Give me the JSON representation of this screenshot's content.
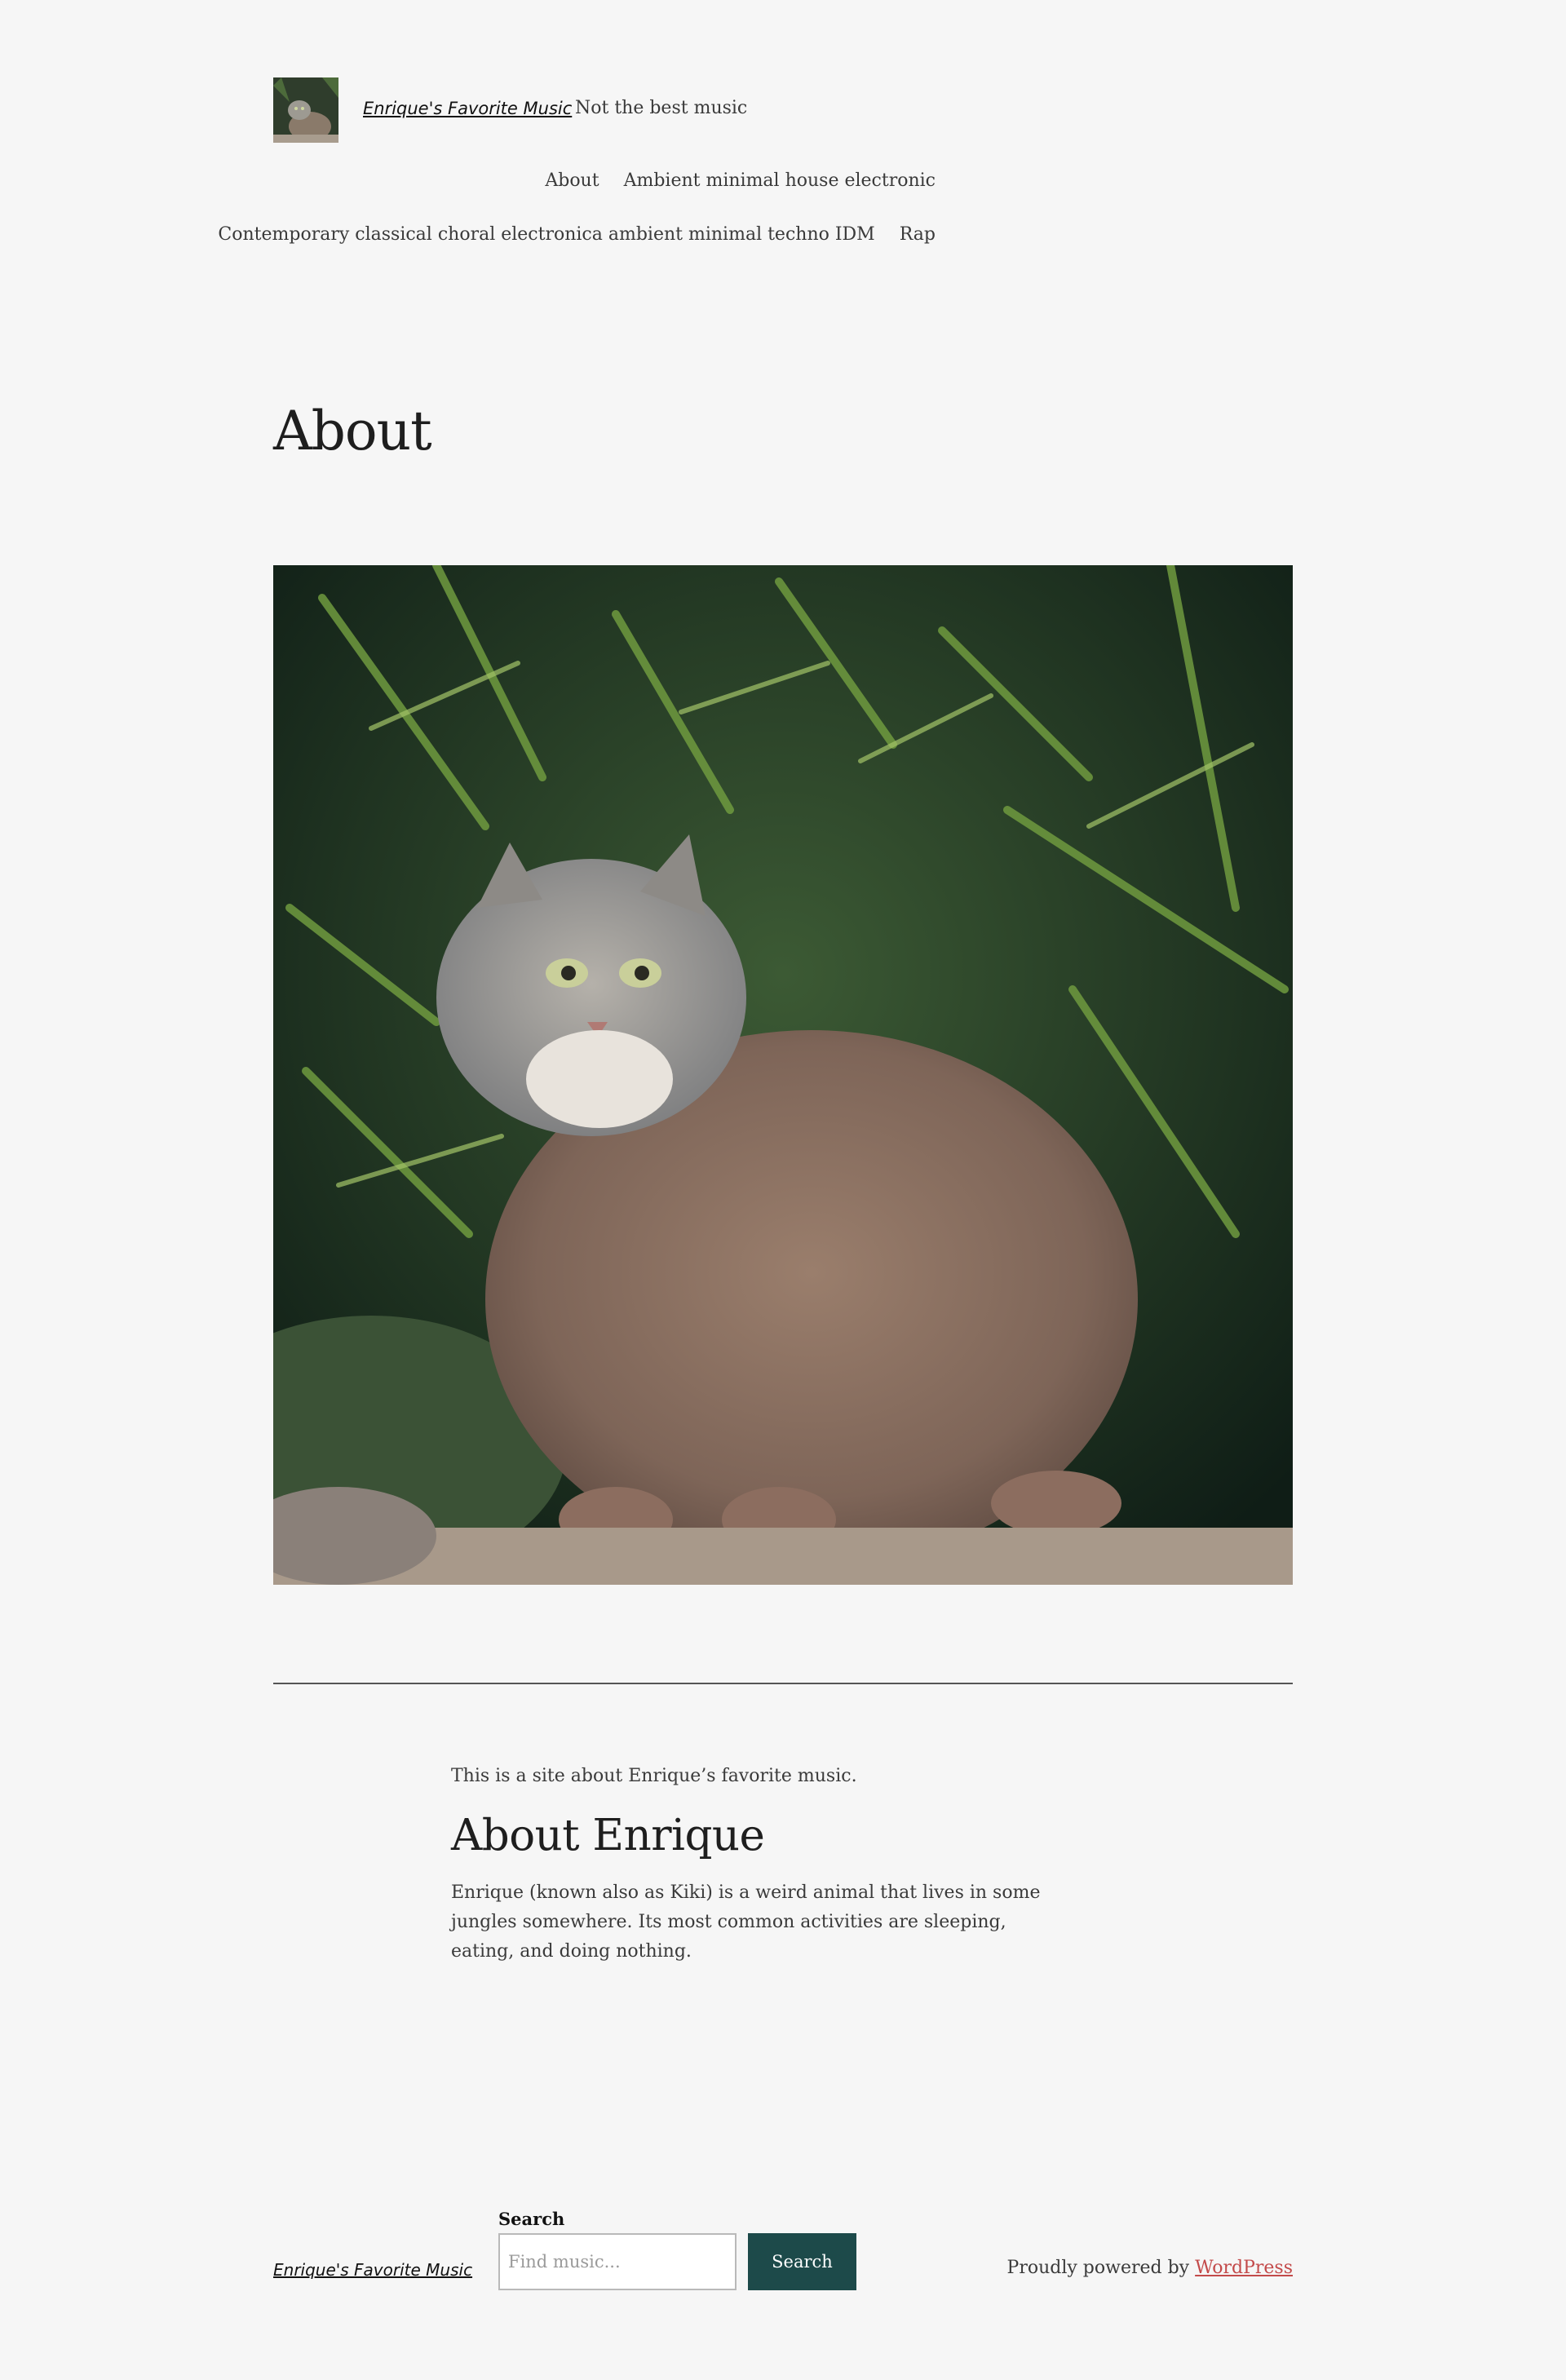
{
  "header": {
    "logo": "pallas-cat-logo",
    "site_title": "Enrique's Favorite Music",
    "tagline": "Not the best music",
    "nav": {
      "row1": [
        {
          "label": "About"
        },
        {
          "label": "Ambient minimal house electronic"
        }
      ],
      "row2": [
        {
          "label": "Contemporary classical choral electronica ambient minimal techno IDM"
        },
        {
          "label": "Rap"
        }
      ]
    }
  },
  "main": {
    "page_title": "About",
    "featured_image": "pallas-cat-photo",
    "intro": "This is a site about Enrique’s favorite music.",
    "heading": "About Enrique",
    "bio": "Enrique (known also as Kiki) is a weird animal that lives in some jungles somewhere. Its most common activities are sleeping, eating, and doing nothing."
  },
  "footer": {
    "site_title": "Enrique's Favorite Music",
    "search": {
      "label": "Search",
      "placeholder": "Find music...",
      "button_label": "Search"
    },
    "powered_prefix": "Proudly powered by",
    "powered_link": "WordPress",
    "link_color": "#c34a4a",
    "button_color": "#1d4a4a"
  }
}
